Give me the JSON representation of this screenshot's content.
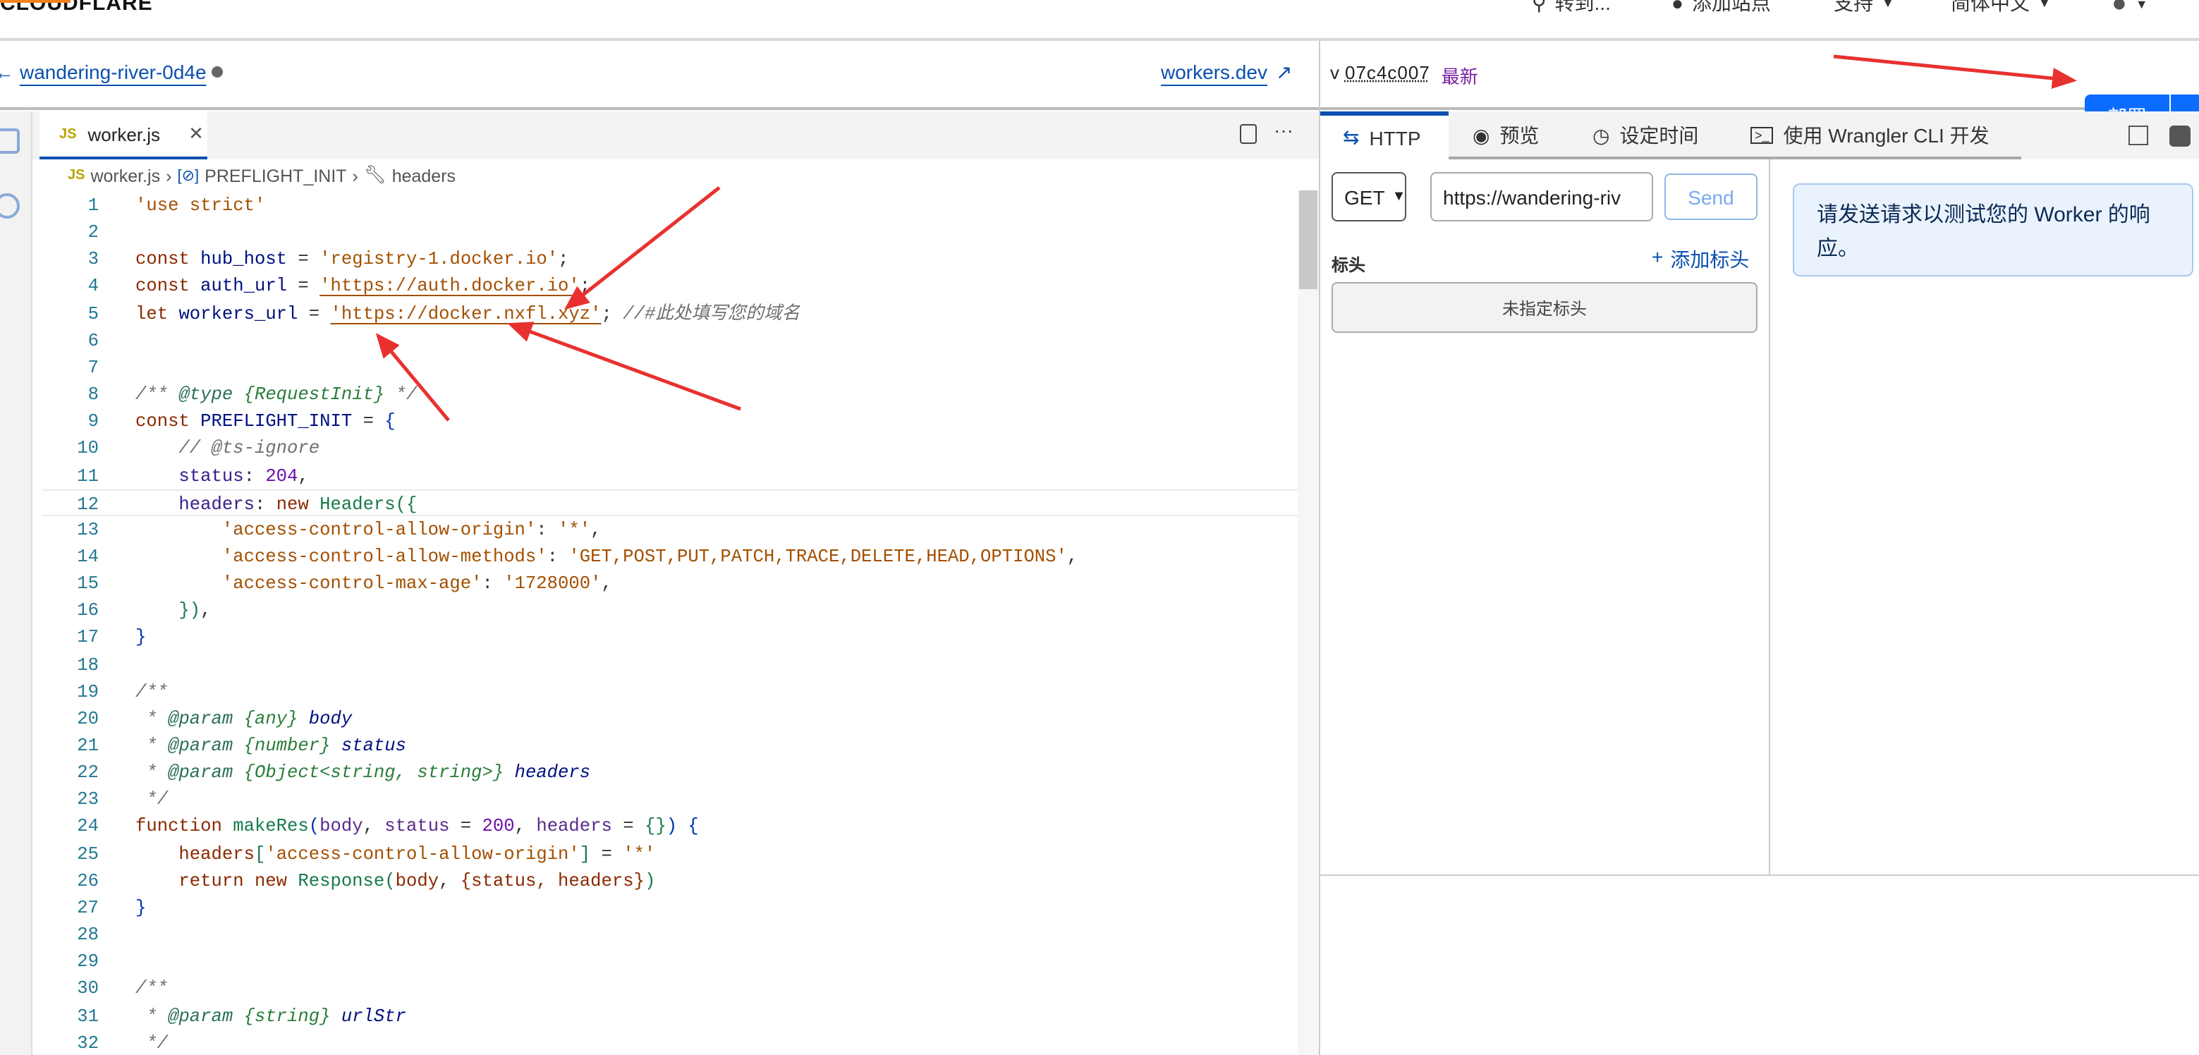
{
  "topbar": {
    "logo": "CLOUDFLARE",
    "nav": [
      {
        "label": "转到...",
        "icon": "search-icon"
      },
      {
        "label": "添加站点",
        "icon": "plus-circle-icon"
      },
      {
        "label": "支持",
        "icon": "chevron-down-icon"
      },
      {
        "label": "简体中文",
        "icon": "chevron-down-icon"
      },
      {
        "label": "",
        "icon": "user-icon"
      }
    ]
  },
  "header": {
    "back_glyph": "←",
    "worker_name": "wandering-river-0d4e",
    "workers_dev": "workers.dev",
    "version_prefix": "v",
    "version": "07c4c007",
    "version_badge": "最新",
    "deploy": "部署"
  },
  "editor": {
    "tab": "worker.js",
    "tab_icon": "JS",
    "breadcrumb": [
      "worker.js",
      "PREFLIGHT_INIT",
      "headers"
    ],
    "current_line": 12,
    "lines": [
      [
        [
          "'use strict'",
          "str"
        ]
      ],
      [],
      [
        [
          "const",
          "kw"
        ],
        [
          " hub_host",
          "var"
        ],
        [
          " = ",
          "pn"
        ],
        [
          "'registry-1.docker.io'",
          "str"
        ],
        [
          ";",
          "pn"
        ]
      ],
      [
        [
          "const",
          "kw"
        ],
        [
          " auth_url",
          "var"
        ],
        [
          " = ",
          "pn"
        ],
        [
          "'https://auth.docker.io'",
          "strU"
        ],
        [
          ";",
          "pn"
        ]
      ],
      [
        [
          "let",
          "kw"
        ],
        [
          " workers_url",
          "var"
        ],
        [
          " = ",
          "pn"
        ],
        [
          "'https://docker.nxfl.xyz'",
          "strU"
        ],
        [
          "; ",
          "pn"
        ],
        [
          "//#此处填写您的域名",
          "cm"
        ]
      ],
      [],
      [],
      [
        [
          "/** ",
          "cm"
        ],
        [
          "@type",
          "tag"
        ],
        [
          " {RequestInit}",
          "type"
        ],
        [
          " */",
          "cm"
        ]
      ],
      [
        [
          "const",
          "kw"
        ],
        [
          " PREFLIGHT_INIT",
          "var"
        ],
        [
          " = ",
          "pn"
        ],
        [
          "{",
          "br"
        ]
      ],
      [
        [
          "    // @ts-ignore",
          "cm"
        ]
      ],
      [
        [
          "    status",
          "prop"
        ],
        [
          ": ",
          "pn"
        ],
        [
          "204",
          "num2"
        ],
        [
          ",",
          "pn"
        ]
      ],
      [
        [
          "    headers",
          "prop"
        ],
        [
          ": ",
          "pn"
        ],
        [
          "new",
          "kw"
        ],
        [
          " Headers",
          "cls"
        ],
        [
          "({",
          "cls"
        ]
      ],
      [
        [
          "        'access-control-allow-origin'",
          "str"
        ],
        [
          ": ",
          "pn"
        ],
        [
          "'*'",
          "str"
        ],
        [
          ",",
          "pn"
        ]
      ],
      [
        [
          "        'access-control-allow-methods'",
          "str"
        ],
        [
          ": ",
          "pn"
        ],
        [
          "'GET,POST,PUT,PATCH,TRACE,DELETE,HEAD,OPTIONS'",
          "str"
        ],
        [
          ",",
          "pn"
        ]
      ],
      [
        [
          "        'access-control-max-age'",
          "str"
        ],
        [
          ": ",
          "pn"
        ],
        [
          "'1728000'",
          "str"
        ],
        [
          ",",
          "pn"
        ]
      ],
      [
        [
          "    })",
          "cls"
        ],
        [
          ",",
          "pn"
        ]
      ],
      [
        [
          "}",
          "br"
        ]
      ],
      [],
      [
        [
          "/**",
          "cm"
        ]
      ],
      [
        [
          " * ",
          "cm"
        ],
        [
          "@param",
          "tag"
        ],
        [
          " {any}",
          "type"
        ],
        [
          " body",
          "pv"
        ]
      ],
      [
        [
          " * ",
          "cm"
        ],
        [
          "@param",
          "tag"
        ],
        [
          " {number}",
          "type"
        ],
        [
          " status",
          "pv"
        ]
      ],
      [
        [
          " * ",
          "cm"
        ],
        [
          "@param",
          "tag"
        ],
        [
          " {Object<string, string>}",
          "type"
        ],
        [
          " headers",
          "pv"
        ]
      ],
      [
        [
          " */",
          "cm"
        ]
      ],
      [
        [
          "function",
          "kw"
        ],
        [
          " makeRes",
          "fn"
        ],
        [
          "(",
          "br"
        ],
        [
          "body",
          "param"
        ],
        [
          ", ",
          "pn"
        ],
        [
          "status",
          "param"
        ],
        [
          " = ",
          "pn"
        ],
        [
          "200",
          "num2"
        ],
        [
          ", ",
          "pn"
        ],
        [
          "headers",
          "param"
        ],
        [
          " = ",
          "pn"
        ],
        [
          "{}",
          "cls"
        ],
        [
          ") ",
          "br"
        ],
        [
          "{",
          "br"
        ]
      ],
      [
        [
          "    headers",
          "kw"
        ],
        [
          "[",
          "cls"
        ],
        [
          "'access-control-allow-origin'",
          "str"
        ],
        [
          "]",
          "cls"
        ],
        [
          " = ",
          "pn"
        ],
        [
          "'*'",
          "str"
        ]
      ],
      [
        [
          "    return",
          "kw"
        ],
        [
          " new",
          "kw"
        ],
        [
          " Response",
          "cls"
        ],
        [
          "(",
          "cls"
        ],
        [
          "body",
          "kw"
        ],
        [
          ", ",
          "pn"
        ],
        [
          "{status, headers}",
          "kw"
        ],
        [
          ")",
          "cls"
        ]
      ],
      [
        [
          "}",
          "br"
        ]
      ],
      [],
      [],
      [
        [
          "/**",
          "cm"
        ]
      ],
      [
        [
          " * ",
          "cm"
        ],
        [
          "@param",
          "tag"
        ],
        [
          " {string}",
          "type"
        ],
        [
          " urlStr",
          "pv"
        ]
      ],
      [
        [
          " */",
          "cm"
        ]
      ]
    ]
  },
  "panel": {
    "tabs": [
      {
        "label": "HTTP",
        "icon": "arrows-swap-icon"
      },
      {
        "label": "预览",
        "icon": "eye-icon"
      },
      {
        "label": "设定时间",
        "icon": "clock-icon"
      },
      {
        "label": "使用 Wrangler CLI 开发",
        "icon": "terminal-icon"
      }
    ],
    "method": "GET",
    "url": "https://wandering-riv",
    "send": "Send",
    "headers_label": "标头",
    "add_header": "添加标头",
    "no_headers": "未指定标头",
    "response_hint": "请发送请求以测试您的 Worker 的响应。"
  },
  "colors": {
    "accent": "#0b6cff",
    "link": "#0a4fb0",
    "badge": "#7b1fa2",
    "annotation": "#e8312f"
  }
}
